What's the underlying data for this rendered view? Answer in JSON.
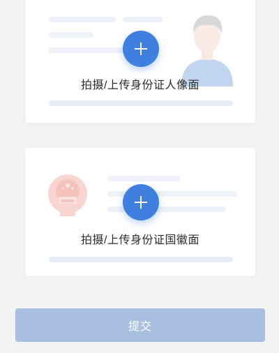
{
  "front_card": {
    "label": "拍摄/上传身份证人像面",
    "add_icon": "plus-icon",
    "illustration": "portrait-illustration"
  },
  "back_card": {
    "label": "拍摄/上传身份证国徽面",
    "add_icon": "plus-icon",
    "illustration": "national-emblem-illustration"
  },
  "submit": {
    "label": "提交"
  },
  "colors": {
    "accent": "#3f7fe0",
    "submit_disabled": "#a8bfe0",
    "background": "#f2f3f5"
  }
}
